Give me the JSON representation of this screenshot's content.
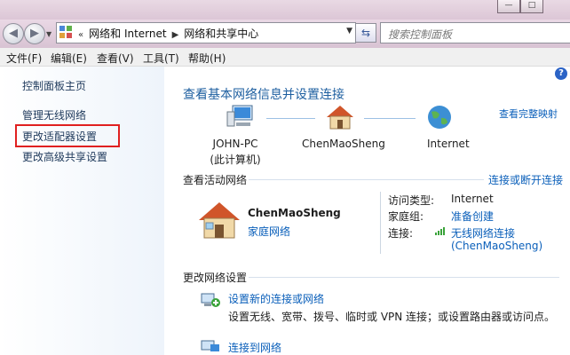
{
  "window": {
    "minimize": "—",
    "maximize": "□"
  },
  "address": {
    "overflow": "«",
    "crumbs": [
      "网络和 Internet",
      "网络和共享中心"
    ],
    "search_placeholder": "搜索控制面板"
  },
  "menu": [
    "文件(F)",
    "编辑(E)",
    "查看(V)",
    "工具(T)",
    "帮助(H)"
  ],
  "sidebar": {
    "items": [
      "控制面板主页",
      "管理无线网络",
      "更改适配器设置",
      "更改高级共享设置"
    ]
  },
  "main": {
    "title": "查看基本网络信息并设置连接",
    "full_map": "查看完整映射",
    "nodes": [
      {
        "label": "JOHN-PC",
        "sub": "(此计算机)"
      },
      {
        "label": "ChenMaoSheng",
        "sub": ""
      },
      {
        "label": "Internet",
        "sub": ""
      }
    ],
    "active_header": "查看活动网络",
    "connect_link": "连接或断开连接",
    "network_name": "ChenMaoSheng",
    "network_type": "家庭网络",
    "access_type_label": "访问类型:",
    "access_type_value": "Internet",
    "homegroup_label": "家庭组:",
    "homegroup_value": "准备创建",
    "connection_label": "连接:",
    "connection_value": "无线网络连接",
    "connection_value2": "(ChenMaoSheng)",
    "change_header": "更改网络设置",
    "task1_title": "设置新的连接或网络",
    "task1_desc": "设置无线、宽带、拨号、临时或 VPN 连接；或设置路由器或访问点。",
    "task2_title": "连接到网络"
  },
  "colors": {
    "link": "#0a5fba",
    "heading": "#1e5fa0",
    "highlight_box": "#e02020"
  }
}
